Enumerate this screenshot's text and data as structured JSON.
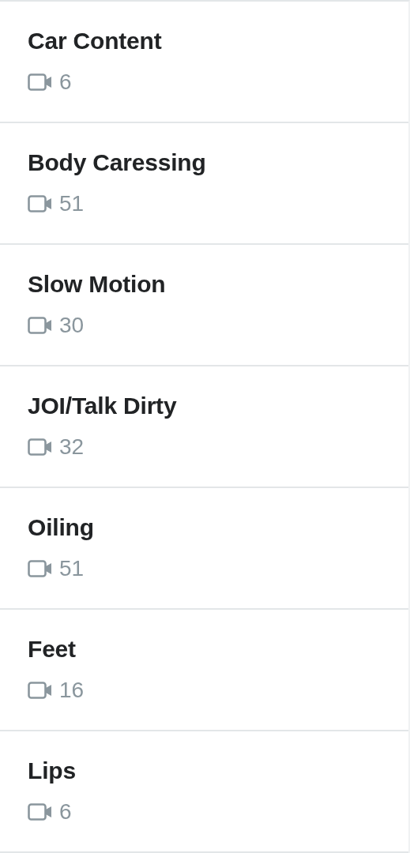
{
  "categories": [
    {
      "title": "Car Content",
      "count": "6"
    },
    {
      "title": "Body Caressing",
      "count": "51"
    },
    {
      "title": "Slow Motion",
      "count": "30"
    },
    {
      "title": "JOI/Talk Dirty",
      "count": "32"
    },
    {
      "title": "Oiling",
      "count": "51"
    },
    {
      "title": "Feet",
      "count": "16"
    },
    {
      "title": "Lips",
      "count": "6"
    }
  ]
}
